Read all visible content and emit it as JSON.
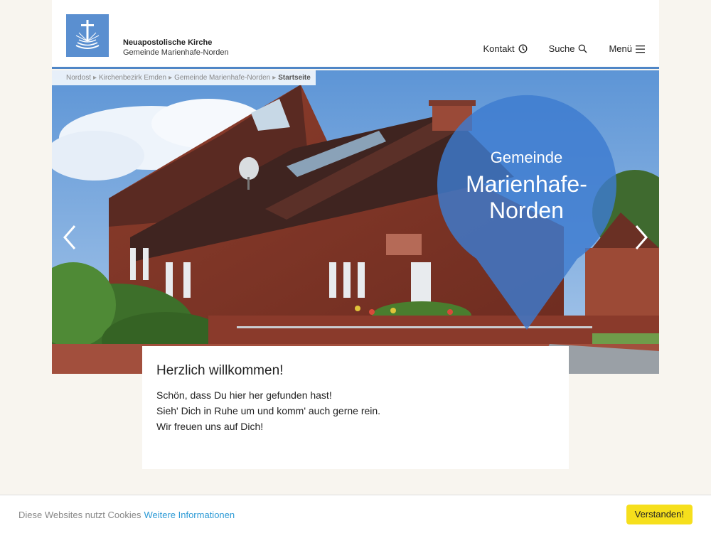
{
  "header": {
    "brand_line1": "Neuapostolische Kirche",
    "brand_line2": "Gemeinde Marienhafe-Norden",
    "nav": [
      {
        "label": "Kontakt",
        "icon": "clock-icon"
      },
      {
        "label": "Suche",
        "icon": "search-icon"
      },
      {
        "label": "Menü",
        "icon": "hamburger-icon"
      }
    ],
    "accent": "#4f86c6",
    "logo_color": "#5a8fd0"
  },
  "breadcrumb": {
    "items": [
      "Nordost",
      "Kirchenbezirk Emden",
      "Gemeinde Marienhafe-Norden"
    ],
    "current": "Startseite"
  },
  "hero": {
    "pin_line1": "Gemeinde",
    "pin_line2": "Marienhafe-",
    "pin_line3": "Norden",
    "pin_color": "#3d7bd0"
  },
  "welcome": {
    "title": "Herzlich willkommen!",
    "line1": "Schön, dass Du hier her gefunden hast!",
    "line2": "Sieh' Dich in Ruhe um und komm' auch gerne rein.",
    "line3": "Wir freuen uns auf Dich!"
  },
  "cookie": {
    "message": "Diese Websites nutzt Cookies",
    "link": "Weitere Informationen",
    "button": "Verstanden!",
    "button_color": "#f6df1c"
  }
}
